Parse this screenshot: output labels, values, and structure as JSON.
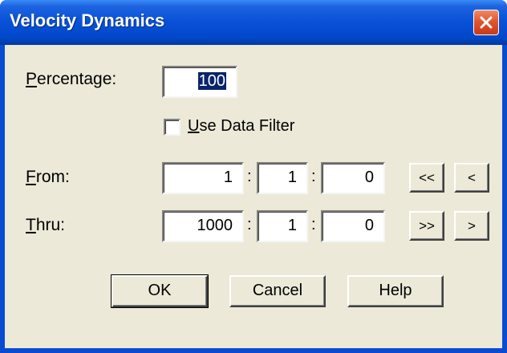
{
  "window": {
    "title": "Velocity Dynamics",
    "close_symbol": "✕"
  },
  "percentage": {
    "label_prefix": "",
    "label_accel": "P",
    "label_rest": "ercentage:",
    "value": "100"
  },
  "data_filter": {
    "label_accel": "U",
    "label_rest": "se Data Filter",
    "checked": false
  },
  "from": {
    "label_accel": "F",
    "label_rest": "rom:",
    "field1": "1",
    "field2": "1",
    "field3": "0",
    "sep": ":",
    "btn_first": "<<",
    "btn_prev": "<"
  },
  "thru": {
    "label_accel": "T",
    "label_rest": "hru:",
    "field1": "1000",
    "field2": "1",
    "field3": "0",
    "sep": ":",
    "btn_last": ">>",
    "btn_next": ">"
  },
  "buttons": {
    "ok": "OK",
    "cancel": "Cancel",
    "help": "Help"
  },
  "colors": {
    "titlebar": "#0a52d8",
    "dialog_bg": "#ece9d8",
    "close_button": "#e2562e",
    "selection": "#0a246a"
  }
}
